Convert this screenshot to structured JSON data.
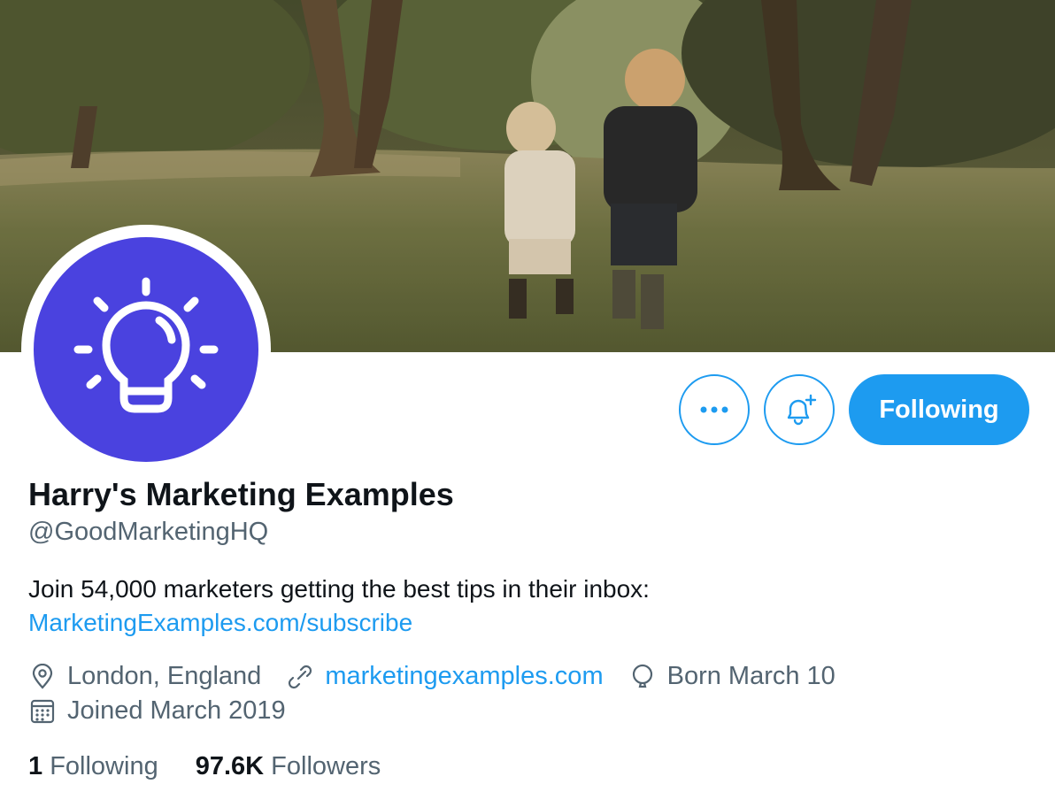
{
  "profile": {
    "name": "Harry's Marketing Examples",
    "handle": "@GoodMarketingHQ",
    "bio_text": "Join 54,000 marketers getting the best tips in their inbox:",
    "bio_link": "MarketingExamples.com/subscribe",
    "location": "London, England",
    "website": "marketingexamples.com",
    "birthday": "Born March 10",
    "joined": "Joined March 2019"
  },
  "actions": {
    "more_icon": "more-dots-icon",
    "notify_icon": "bell-plus-icon",
    "follow_label": "Following"
  },
  "stats": {
    "following_count": "1",
    "following_label": "Following",
    "followers_count": "97.6K",
    "followers_label": "Followers"
  },
  "colors": {
    "accent": "#1d9bf0",
    "avatar_bg": "#4a42df",
    "muted_text": "#536471"
  },
  "icons": {
    "avatar": "lightbulb-icon",
    "location": "location-pin-icon",
    "website": "link-icon",
    "birthday": "balloon-icon",
    "joined": "calendar-icon"
  }
}
